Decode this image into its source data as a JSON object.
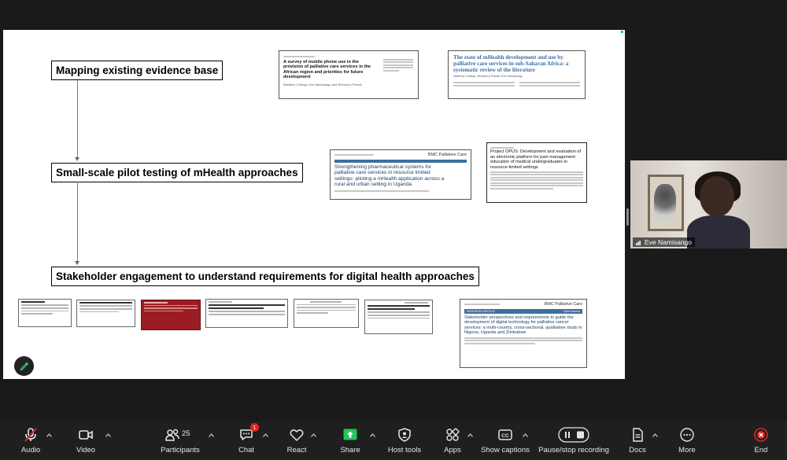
{
  "slide": {
    "boxes": [
      "Mapping existing evidence base",
      "Small-scale pilot testing of mHealth approaches",
      "Stakeholder engagement to understand requirements for digital health approaches"
    ],
    "papers": {
      "mobile_phone": {
        "title": "A survey of mobile phone use in the provision of palliative care services in the African region and priorities for future development",
        "authors": "Matthew J Allsop, Eve Namisango and Richard A Powell"
      },
      "state_mhealth": {
        "title": "The state of mHealth development and use by palliative care services in sub-Saharan Africa: a systematic review of the literature",
        "authors": "Matthew J Allsop, Richard A Powell, Eve Namisango"
      },
      "pharma": {
        "journal": "BMC Palliative Care",
        "title": "Strengthening pharmaceutical systems for palliative care services in resource limited settings: piloting a mHealth application across a rural and urban setting in Uganda"
      },
      "opus": {
        "title": "Project OPUS: Development and evaluation of an electronic platform for pain management education of medical undergraduates in resource-limited settings"
      },
      "stakeholder": {
        "journal": "BMC Palliative Care",
        "tag": "RESEARCH ARTICLE",
        "access": "Open Access",
        "title": "Stakeholder perspectives and requirements to guide the development of digital technology for palliative cancer services: a multi-country, cross-sectional, qualitative study in Nigeria, Uganda and Zimbabwe"
      }
    }
  },
  "video": {
    "name": "Eve Namisango"
  },
  "toolbar": {
    "audio": "Audio",
    "video": "Video",
    "participants": "Participants",
    "participants_count": "25",
    "chat": "Chat",
    "chat_badge": "1",
    "react": "React",
    "share": "Share",
    "host_tools": "Host tools",
    "apps": "Apps",
    "captions": "Show captions",
    "recording": "Pause/stop recording",
    "docs": "Docs",
    "more": "More",
    "end": "End"
  },
  "colors": {
    "share_green": "#23c45e",
    "end_red": "#e02424",
    "badge_red": "#e02424",
    "arrow_blue": "#4a6f96"
  }
}
